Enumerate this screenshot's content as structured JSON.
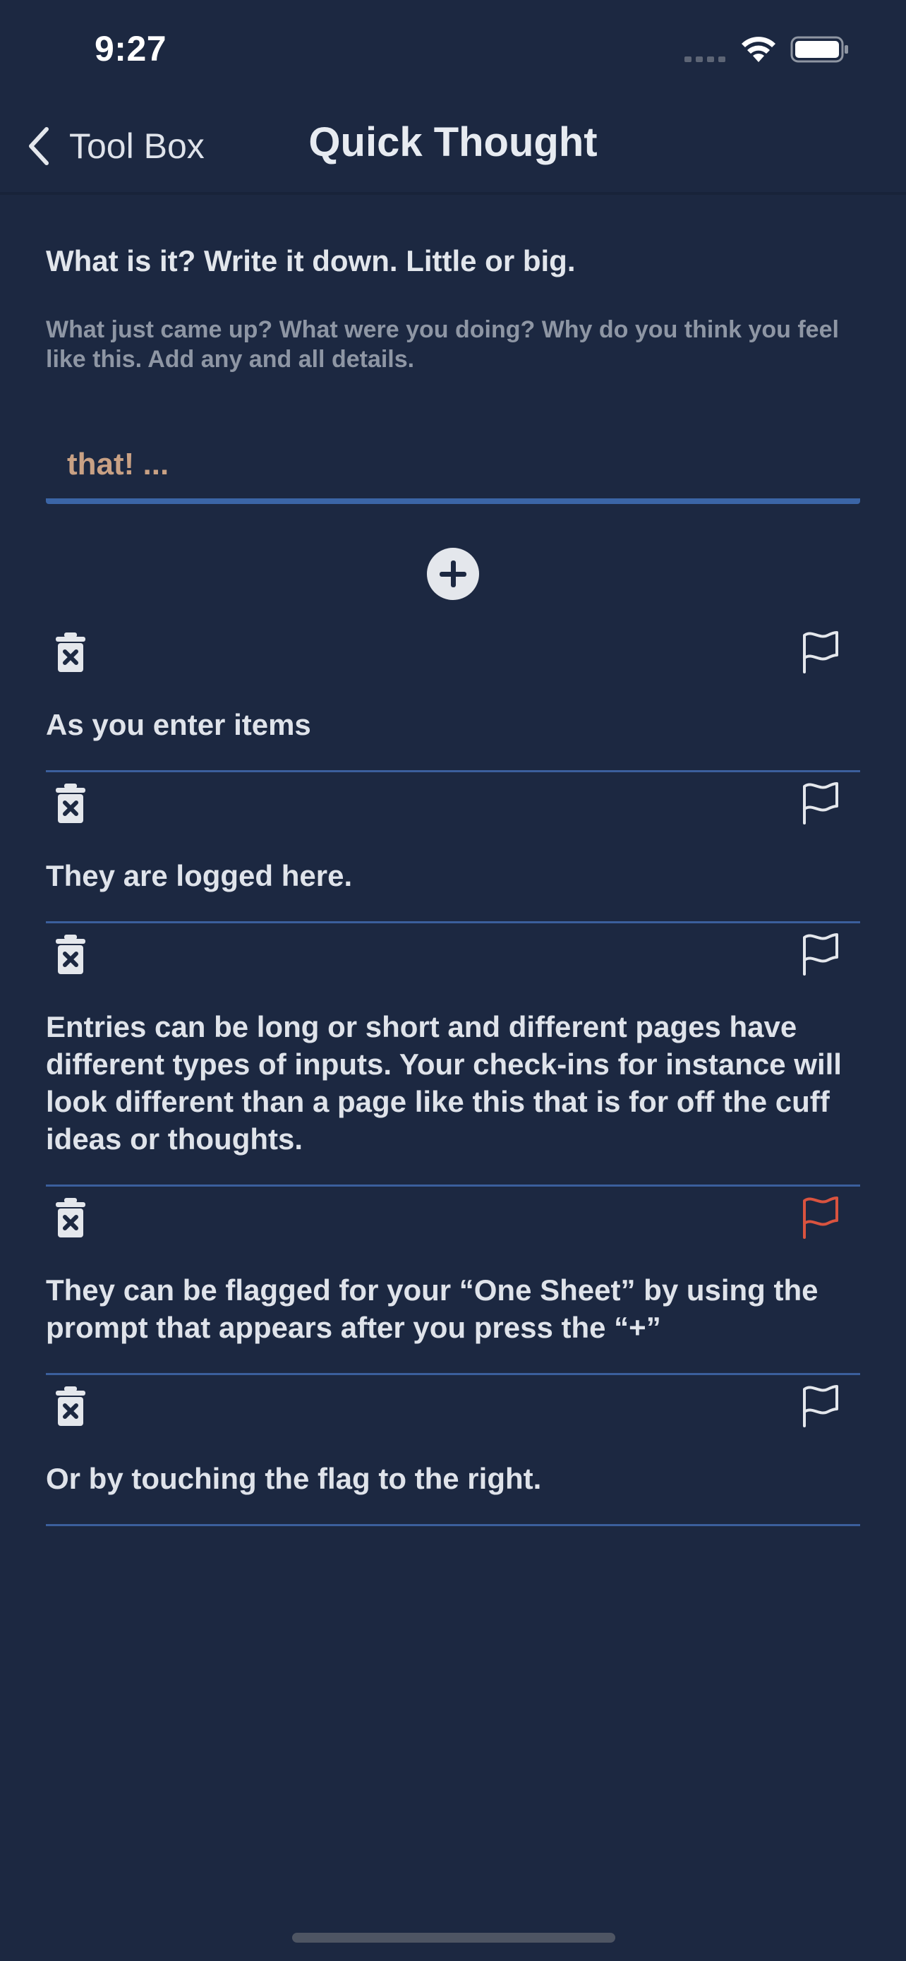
{
  "status_bar": {
    "time": "9:27"
  },
  "nav": {
    "back_label": "Tool Box",
    "title": "Quick Thought"
  },
  "prompt": {
    "heading": "What is it? Write it down. Little or big.",
    "subtext": "What just came up? What were you doing? Why do you think you feel like this. Add any and all details."
  },
  "input": {
    "placeholder": "that! ..."
  },
  "log_items": [
    {
      "text": "As you enter items",
      "flagged": false
    },
    {
      "text": "They are logged here.",
      "flagged": false
    },
    {
      "text": "Entries can be long or short and different pages have different types of inputs. Your check-ins for instance will look different than a page like this that is for off the cuff ideas or thoughts.",
      "flagged": false
    },
    {
      "text": "They can be flagged for your “One Sheet” by using the prompt that appears after you press the “+”",
      "flagged": true
    },
    {
      "text": "Or by touching the flag to the right.",
      "flagged": false
    }
  ],
  "colors": {
    "background": "#1c2841",
    "accent_line": "#3b65a6",
    "flag_active": "#d9533f",
    "flag_inactive": "#e4e7ec",
    "placeholder": "#c9a184"
  },
  "icons": {
    "back": "chevron-left-icon",
    "add": "plus-circle-icon",
    "delete": "trash-x-icon",
    "flag": "flag-icon"
  }
}
